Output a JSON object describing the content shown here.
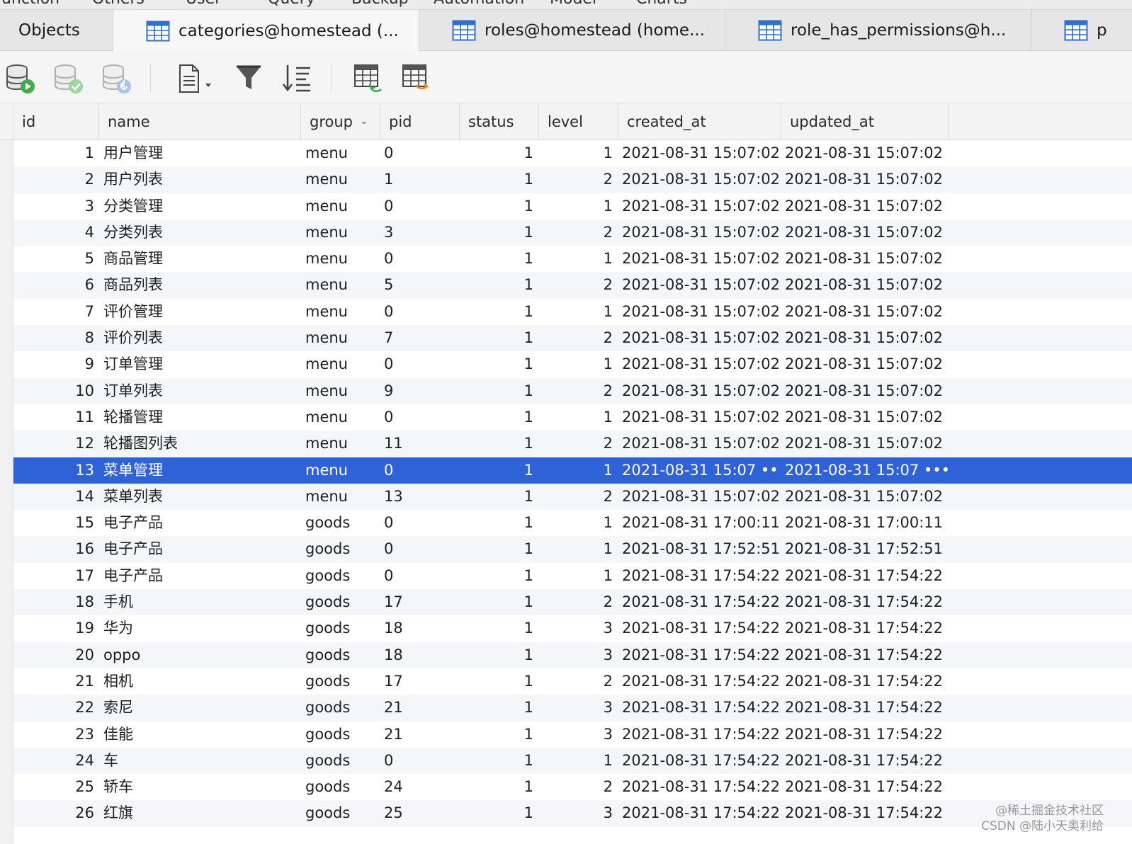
{
  "menu_strip": [
    "unction",
    "Others",
    "User",
    "Query",
    "Backup",
    "Automation",
    "Model",
    "Charts"
  ],
  "tabs": [
    {
      "label": "Objects"
    },
    {
      "label": "categories@homestead (..."
    },
    {
      "label": "roles@homestead (home..."
    },
    {
      "label": "role_has_permissions@h..."
    },
    {
      "label": "p"
    }
  ],
  "columns": [
    "id",
    "name",
    "group",
    "pid",
    "status",
    "level",
    "created_at",
    "updated_at"
  ],
  "sorted_column": "group",
  "selected_row_id": "13",
  "rows": [
    {
      "id": "1",
      "name": "用户管理",
      "group": "menu",
      "pid": "0",
      "status": "1",
      "level": "1",
      "created_at": "2021-08-31 15:07:02",
      "updated_at": "2021-08-31 15:07:02"
    },
    {
      "id": "2",
      "name": "用户列表",
      "group": "menu",
      "pid": "1",
      "status": "1",
      "level": "2",
      "created_at": "2021-08-31 15:07:02",
      "updated_at": "2021-08-31 15:07:02"
    },
    {
      "id": "3",
      "name": "分类管理",
      "group": "menu",
      "pid": "0",
      "status": "1",
      "level": "1",
      "created_at": "2021-08-31 15:07:02",
      "updated_at": "2021-08-31 15:07:02"
    },
    {
      "id": "4",
      "name": "分类列表",
      "group": "menu",
      "pid": "3",
      "status": "1",
      "level": "2",
      "created_at": "2021-08-31 15:07:02",
      "updated_at": "2021-08-31 15:07:02"
    },
    {
      "id": "5",
      "name": "商品管理",
      "group": "menu",
      "pid": "0",
      "status": "1",
      "level": "1",
      "created_at": "2021-08-31 15:07:02",
      "updated_at": "2021-08-31 15:07:02"
    },
    {
      "id": "6",
      "name": "商品列表",
      "group": "menu",
      "pid": "5",
      "status": "1",
      "level": "2",
      "created_at": "2021-08-31 15:07:02",
      "updated_at": "2021-08-31 15:07:02"
    },
    {
      "id": "7",
      "name": "评价管理",
      "group": "menu",
      "pid": "0",
      "status": "1",
      "level": "1",
      "created_at": "2021-08-31 15:07:02",
      "updated_at": "2021-08-31 15:07:02"
    },
    {
      "id": "8",
      "name": "评价列表",
      "group": "menu",
      "pid": "7",
      "status": "1",
      "level": "2",
      "created_at": "2021-08-31 15:07:02",
      "updated_at": "2021-08-31 15:07:02"
    },
    {
      "id": "9",
      "name": "订单管理",
      "group": "menu",
      "pid": "0",
      "status": "1",
      "level": "1",
      "created_at": "2021-08-31 15:07:02",
      "updated_at": "2021-08-31 15:07:02"
    },
    {
      "id": "10",
      "name": "订单列表",
      "group": "menu",
      "pid": "9",
      "status": "1",
      "level": "2",
      "created_at": "2021-08-31 15:07:02",
      "updated_at": "2021-08-31 15:07:02"
    },
    {
      "id": "11",
      "name": "轮播管理",
      "group": "menu",
      "pid": "0",
      "status": "1",
      "level": "1",
      "created_at": "2021-08-31 15:07:02",
      "updated_at": "2021-08-31 15:07:02"
    },
    {
      "id": "12",
      "name": "轮播图列表",
      "group": "menu",
      "pid": "11",
      "status": "1",
      "level": "2",
      "created_at": "2021-08-31 15:07:02",
      "updated_at": "2021-08-31 15:07:02"
    },
    {
      "id": "13",
      "name": "菜单管理",
      "group": "menu",
      "pid": "0",
      "status": "1",
      "level": "1",
      "created_at": "2021-08-31 15:07 •••",
      "updated_at": "2021-08-31 15:07 •••"
    },
    {
      "id": "14",
      "name": "菜单列表",
      "group": "menu",
      "pid": "13",
      "status": "1",
      "level": "2",
      "created_at": "2021-08-31 15:07:02",
      "updated_at": "2021-08-31 15:07:02"
    },
    {
      "id": "15",
      "name": "电子产品",
      "group": "goods",
      "pid": "0",
      "status": "1",
      "level": "1",
      "created_at": "2021-08-31 17:00:11",
      "updated_at": "2021-08-31 17:00:11"
    },
    {
      "id": "16",
      "name": "电子产品",
      "group": "goods",
      "pid": "0",
      "status": "1",
      "level": "1",
      "created_at": "2021-08-31 17:52:51",
      "updated_at": "2021-08-31 17:52:51"
    },
    {
      "id": "17",
      "name": "电子产品",
      "group": "goods",
      "pid": "0",
      "status": "1",
      "level": "1",
      "created_at": "2021-08-31 17:54:22",
      "updated_at": "2021-08-31 17:54:22"
    },
    {
      "id": "18",
      "name": "手机",
      "group": "goods",
      "pid": "17",
      "status": "1",
      "level": "2",
      "created_at": "2021-08-31 17:54:22",
      "updated_at": "2021-08-31 17:54:22"
    },
    {
      "id": "19",
      "name": "华为",
      "group": "goods",
      "pid": "18",
      "status": "1",
      "level": "3",
      "created_at": "2021-08-31 17:54:22",
      "updated_at": "2021-08-31 17:54:22"
    },
    {
      "id": "20",
      "name": "oppo",
      "group": "goods",
      "pid": "18",
      "status": "1",
      "level": "3",
      "created_at": "2021-08-31 17:54:22",
      "updated_at": "2021-08-31 17:54:22"
    },
    {
      "id": "21",
      "name": "相机",
      "group": "goods",
      "pid": "17",
      "status": "1",
      "level": "2",
      "created_at": "2021-08-31 17:54:22",
      "updated_at": "2021-08-31 17:54:22"
    },
    {
      "id": "22",
      "name": "索尼",
      "group": "goods",
      "pid": "21",
      "status": "1",
      "level": "3",
      "created_at": "2021-08-31 17:54:22",
      "updated_at": "2021-08-31 17:54:22"
    },
    {
      "id": "23",
      "name": "佳能",
      "group": "goods",
      "pid": "21",
      "status": "1",
      "level": "3",
      "created_at": "2021-08-31 17:54:22",
      "updated_at": "2021-08-31 17:54:22"
    },
    {
      "id": "24",
      "name": "车",
      "group": "goods",
      "pid": "0",
      "status": "1",
      "level": "1",
      "created_at": "2021-08-31 17:54:22",
      "updated_at": "2021-08-31 17:54:22"
    },
    {
      "id": "25",
      "name": "轿车",
      "group": "goods",
      "pid": "24",
      "status": "1",
      "level": "2",
      "created_at": "2021-08-31 17:54:22",
      "updated_at": "2021-08-31 17:54:22"
    },
    {
      "id": "26",
      "name": "红旗",
      "group": "goods",
      "pid": "25",
      "status": "1",
      "level": "3",
      "created_at": "2021-08-31 17:54:22",
      "updated_at": "2021-08-31 17:54:22"
    }
  ],
  "watermark": [
    "@稀土掘金技术社区",
    "CSDN @陆小天奥利给"
  ],
  "colors": {
    "selection": "#2f62d6",
    "tab_active": "#f7f7f7",
    "icon_blue": "#2d6fd6",
    "icon_green": "#3fae48"
  }
}
